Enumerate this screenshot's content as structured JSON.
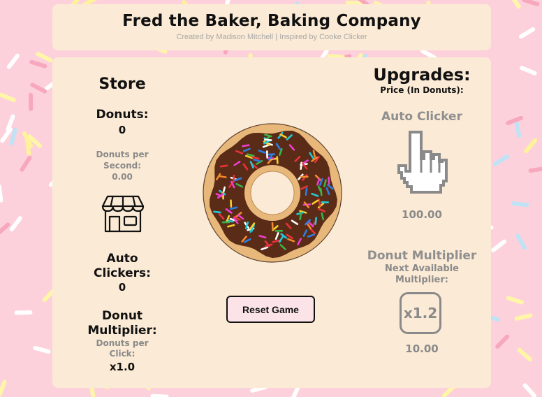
{
  "header": {
    "title": "Fred the Baker, Baking Company",
    "subtitle": "Created by Madison Mitchell | Inspired by Cooke Clicker"
  },
  "store": {
    "title": "Store",
    "donuts_label": "Donuts:",
    "donuts_value": "0",
    "dps_label_1": "Donuts per",
    "dps_label_2": "Second:",
    "dps_value": "0.00",
    "store_icon": "storefront-icon",
    "auto_label_1": "Auto",
    "auto_label_2": "Clickers:",
    "auto_value": "0",
    "mult_label_1": "Donut",
    "mult_label_2": "Multiplier:",
    "dpc_label_1": "Donuts per",
    "dpc_label_2": "Click:",
    "dpc_value": "x1.0"
  },
  "center": {
    "donut_icon": "donut-icon",
    "reset_label": "Reset Game"
  },
  "upgrades": {
    "title": "Upgrades:",
    "price_note": "Price (In Donuts):",
    "auto_clicker_title": "Auto Clicker",
    "auto_clicker_icon": "pointing-hand-cursor-icon",
    "auto_clicker_price": "100.00",
    "multiplier_title": "Donut Multiplier",
    "next_label_1": "Next Available",
    "next_label_2": "Multiplier:",
    "multiplier_button": "x1.2",
    "multiplier_price": "10.00"
  },
  "colors": {
    "background": "#fdd1dc",
    "panel": "#fbead5",
    "donut_dough": "#e8b77a",
    "donut_chocolate": "#5a2b16",
    "muted_text": "#8a8a8a"
  }
}
